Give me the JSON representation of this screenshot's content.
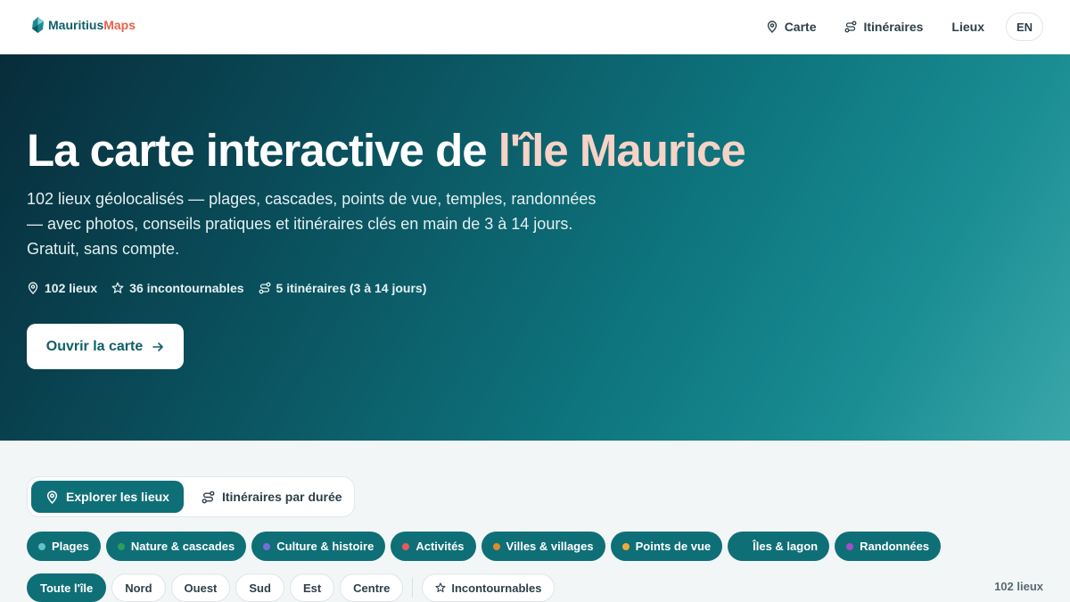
{
  "brand": {
    "name_part1": "Mauritius",
    "name_part2": "Maps",
    "color_primary": "#0f5f68",
    "color_accent": "#e4634a"
  },
  "nav": {
    "items": [
      {
        "label": "Carte",
        "icon": "map-pin-icon"
      },
      {
        "label": "Itinéraires",
        "icon": "route-icon"
      },
      {
        "label": "Lieux"
      }
    ],
    "lang": "EN"
  },
  "hero": {
    "title_main": "La carte interactive de ",
    "title_accent": "l'île Maurice",
    "subtitle": "102 lieux géolocalisés — plages, cascades, points de vue, temples, randonnées — avec photos, conseils pratiques et itinéraires clés en main de 3 à 14 jours. Gratuit, sans compte.",
    "stats": [
      {
        "label": "102 lieux",
        "icon": "map-pin-icon"
      },
      {
        "label": "36 incontournables",
        "icon": "star-icon"
      },
      {
        "label": "5 itinéraires (3 à 14 jours)",
        "icon": "route-icon"
      }
    ],
    "cta_label": "Ouvrir la carte"
  },
  "modes": [
    {
      "label": "Explorer les lieux",
      "icon": "map-pin-icon",
      "active": true
    },
    {
      "label": "Itinéraires par durée",
      "icon": "route-icon",
      "active": false
    }
  ],
  "categories": [
    {
      "label": "Plages",
      "color": "#5fc3c9"
    },
    {
      "label": "Nature & cascades",
      "color": "#2e9e5b"
    },
    {
      "label": "Culture & histoire",
      "color": "#7b6bd6"
    },
    {
      "label": "Activités",
      "color": "#e85a5a"
    },
    {
      "label": "Villes & villages",
      "color": "#e08a2b"
    },
    {
      "label": "Points de vue",
      "color": "#f2a93b"
    },
    {
      "label": "Îles & lagon",
      "color": "#0f6f77"
    },
    {
      "label": "Randonnées",
      "color": "#a24fc9"
    }
  ],
  "regions": [
    {
      "label": "Toute l'île",
      "active": true
    },
    {
      "label": "Nord",
      "active": false
    },
    {
      "label": "Ouest",
      "active": false
    },
    {
      "label": "Sud",
      "active": false
    },
    {
      "label": "Est",
      "active": false
    },
    {
      "label": "Centre",
      "active": false
    }
  ],
  "must_see_filter": {
    "label": "Incontournables",
    "icon": "star-icon"
  },
  "results_count": "102 lieux"
}
